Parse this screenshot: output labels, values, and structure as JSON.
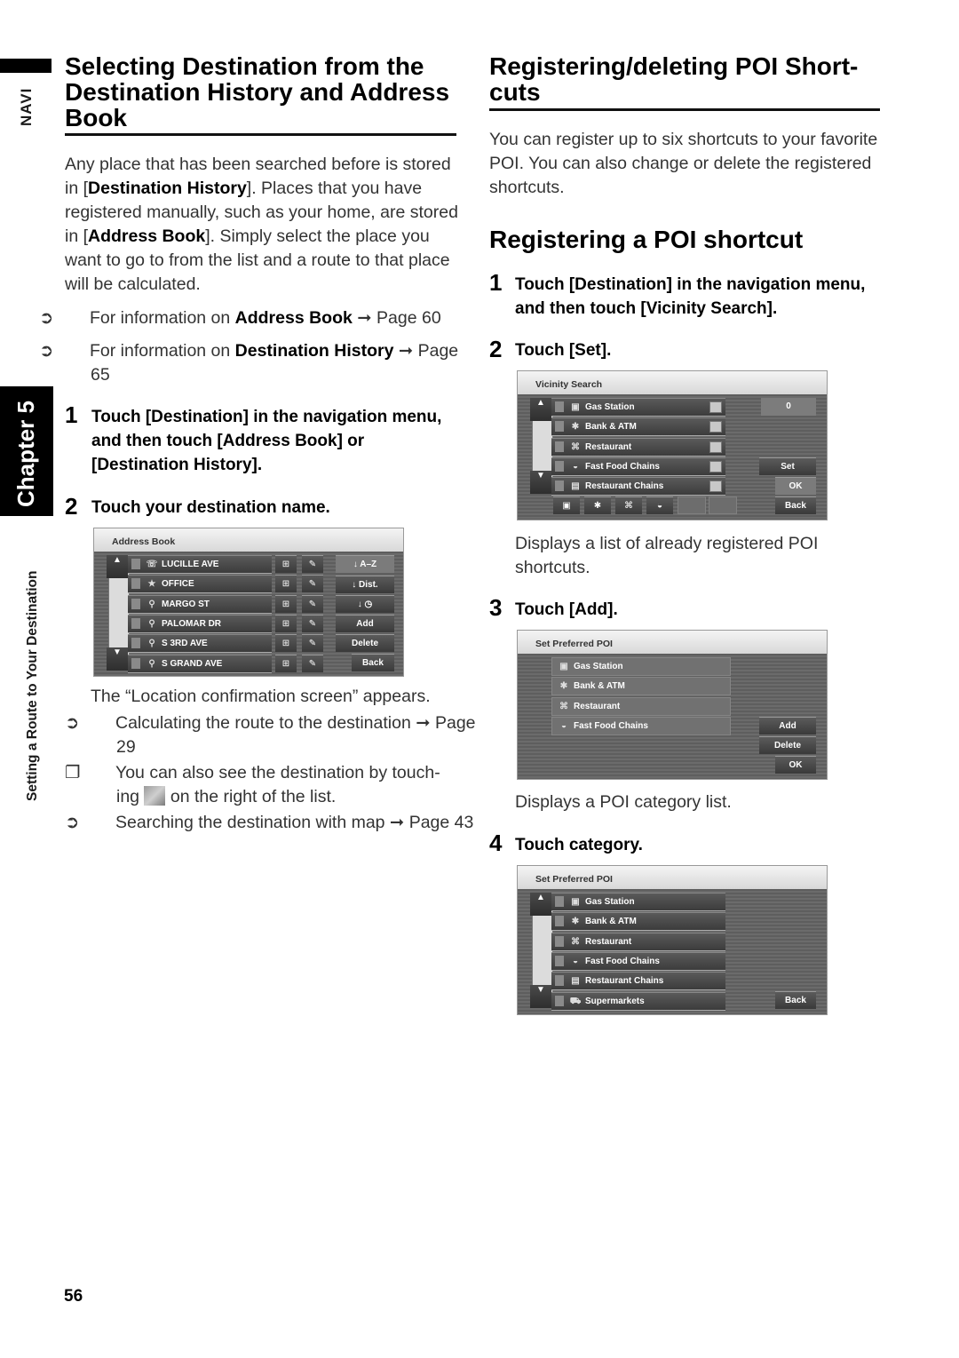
{
  "side": {
    "navi_label": "NAVI",
    "chapter_label": "Chapter 5",
    "section_label": "Setting a Route to Your Destination"
  },
  "left": {
    "heading": "Selecting Destination from the Destination History and Address Book",
    "intro": {
      "p1": "Any place that has been searched before is stored in [",
      "b1": "Destination History",
      "p2": "]. Places that you have registered manually, such as your home, are stored in [",
      "b2": "Address Book",
      "p3": "]. Simply select the place you want to go to from the list and a route to that place will be calculated."
    },
    "refs": [
      {
        "prefix": "For information on ",
        "bold": "Address Book",
        "suffix": " ➞ Page 60"
      },
      {
        "prefix": "For information on ",
        "bold": "Destination History",
        "suffix": " ➞ Page 65"
      }
    ],
    "steps": [
      {
        "num": "1",
        "text": "Touch [Destination] in the navigation menu, and then touch [Address Book] or [Destination History]."
      },
      {
        "num": "2",
        "text": "Touch your destination name."
      }
    ],
    "address_book_screen": {
      "title": "Address Book",
      "entries": [
        {
          "icon": "☏",
          "name": "LUCILLE AVE"
        },
        {
          "icon": "★",
          "name": "OFFICE"
        },
        {
          "icon": "⚲",
          "name": "MARGO ST"
        },
        {
          "icon": "⚲",
          "name": "PALOMAR DR"
        },
        {
          "icon": "⚲",
          "name": "S 3RD AVE"
        },
        {
          "icon": "⚲",
          "name": "S GRAND AVE"
        }
      ],
      "sort_buttons": [
        "↓ A–Z",
        "↓ Dist.",
        "↓ ◷"
      ],
      "add_label": "Add",
      "delete_label": "Delete",
      "back_label": "Back",
      "scroll_up": "▲",
      "scroll_down": "▼"
    },
    "after": {
      "appears": "The “Location confirmation screen” appears.",
      "ref_calc": "Calculating the route to the destination ➞ Page 29",
      "note_a": "You can also see the destination by touch-",
      "note_b_pre": "ing ",
      "note_b_post": " on the right of the list.",
      "ref_map": "Searching the destination with map ➞ Page 43"
    }
  },
  "right": {
    "heading": "Registering/deleting POI Short-cuts",
    "intro": "You can register up to six shortcuts to your favorite POI. You can also change or delete the registered shortcuts.",
    "subheading": "Registering a POI shortcut",
    "steps": [
      {
        "num": "1",
        "text": "Touch [Destination] in the navigation menu, and then touch [Vicinity Search]."
      },
      {
        "num": "2",
        "text": "Touch [Set]."
      },
      {
        "num": "3",
        "text": "Touch [Add]."
      },
      {
        "num": "4",
        "text": "Touch category."
      }
    ],
    "caption_set": "Displays a list of already registered POI shortcuts.",
    "caption_add": "Displays a POI category list.",
    "vicinity_screen": {
      "title": "Vicinity Search",
      "items": [
        {
          "icon": "▣",
          "name": "Gas Station"
        },
        {
          "icon": "✱",
          "name": "Bank & ATM"
        },
        {
          "icon": "⌘",
          "name": "Restaurant"
        },
        {
          "icon": "◒",
          "name": "Fast Food Chains"
        },
        {
          "icon": "▤",
          "name": "Restaurant Chains"
        }
      ],
      "distance_value": "0",
      "shortcut_icons": [
        "▣",
        "✱",
        "⌘",
        "◒"
      ],
      "set_label": "Set",
      "ok_label": "OK",
      "back_label": "Back"
    },
    "preferred_screen": {
      "title": "Set Preferred POI",
      "items": [
        {
          "icon": "▣",
          "name": "Gas Station"
        },
        {
          "icon": "✱",
          "name": "Bank & ATM"
        },
        {
          "icon": "⌘",
          "name": "Restaurant"
        },
        {
          "icon": "◒",
          "name": "Fast Food Chains"
        }
      ],
      "add_label": "Add",
      "delete_label": "Delete",
      "ok_label": "OK"
    },
    "category_screen": {
      "title": "Set Preferred POI",
      "items": [
        {
          "icon": "▣",
          "name": "Gas Station"
        },
        {
          "icon": "✱",
          "name": "Bank & ATM"
        },
        {
          "icon": "⌘",
          "name": "Restaurant"
        },
        {
          "icon": "◒",
          "name": "Fast Food Chains"
        },
        {
          "icon": "▤",
          "name": "Restaurant Chains"
        },
        {
          "icon": "⛟",
          "name": "Supermarkets"
        }
      ],
      "back_label": "Back"
    }
  },
  "footer": {
    "page_number": "56"
  }
}
